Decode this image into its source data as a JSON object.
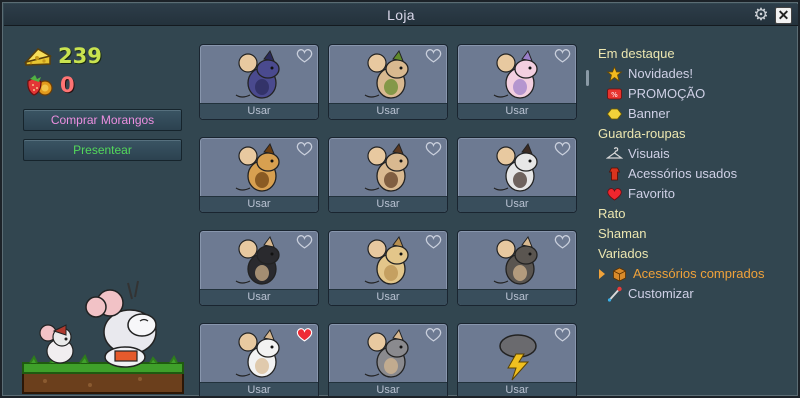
{
  "window": {
    "title": "Loja"
  },
  "currency": {
    "cheese": "239",
    "strawberries": "0"
  },
  "buttons": {
    "buy_strawberries": "Comprar Morangos",
    "gift": "Presentear"
  },
  "grid": {
    "use_label": "Usar",
    "items": [
      {
        "name": "dark-starry-mouse",
        "favorite": false
      },
      {
        "name": "green-frog-mouse",
        "favorite": false
      },
      {
        "name": "pink-unicorn-mouse",
        "favorite": false
      },
      {
        "name": "leopard-mouse",
        "favorite": false
      },
      {
        "name": "brown-fur-mouse",
        "favorite": false
      },
      {
        "name": "panda-mouse",
        "favorite": false
      },
      {
        "name": "black-cat-mouse",
        "favorite": false
      },
      {
        "name": "beige-bunny-mouse",
        "favorite": false
      },
      {
        "name": "gray-bat-mouse",
        "favorite": false
      },
      {
        "name": "white-bunny-mouse",
        "favorite": true
      },
      {
        "name": "gray-sleepy-mouse",
        "favorite": false
      },
      {
        "name": "storm-cloud-item",
        "favorite": false
      }
    ]
  },
  "menu": {
    "featured": "Em destaque",
    "news": "Novidades!",
    "promo": "PROMOÇÃO",
    "banner": "Banner",
    "wardrobe": "Guarda-roupas",
    "visuals": "Visuais",
    "used_accessories": "Acessórios usados",
    "favorite": "Favorito",
    "mouse": "Rato",
    "shaman": "Shaman",
    "various": "Variados",
    "bought_accessories": "Acessórios comprados",
    "customize": "Customizar"
  },
  "colors": {
    "panel": "#324650",
    "card": "#6d7a92",
    "cheese": "#c9e34f",
    "strawberry": "#ff7474",
    "menu_active": "#f0a23a"
  }
}
